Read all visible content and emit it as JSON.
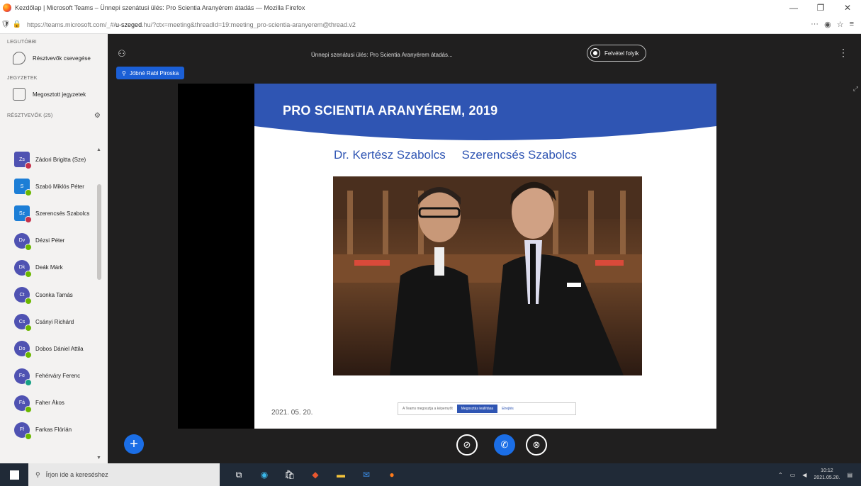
{
  "browser": {
    "title": "Kezdőlap | Microsoft Teams – Ünnepi szenátusi ülés: Pro Scientia Aranyérem átadás — Mozilla Firefox",
    "url_prefix": "https://teams.microsoft.com/_#/",
    "url_domain": "u-szeged",
    "url_rest": ".hu/?ctx=meeting&threadId=19:meeting_pro-scientia-aranyerem@thread.v2",
    "menu_glyph": "≡",
    "star_glyph": "☆",
    "dots_glyph": "···",
    "min_glyph": "—",
    "max_glyph": "❐",
    "close_glyph": "✕"
  },
  "sidebar": {
    "section_teams": "LEGUTÓBBI",
    "section_notes": "JEGYZETEK",
    "section_people": "RÉSZTVEVŐK (25)",
    "item_chat": "Résztvevők csevegése",
    "item_notes": "Megosztott jegyzetek",
    "gear_glyph": "⚙",
    "people": [
      {
        "initials": "Zs",
        "name": "Zádori Brigitta (Sze)",
        "shape": "sq",
        "status": "red",
        "color": ""
      },
      {
        "initials": "S",
        "name": "Szabó Miklós Péter",
        "shape": "sq",
        "status": "",
        "color": "blue"
      },
      {
        "initials": "Sz",
        "name": "Szerencsés Szabolcs",
        "shape": "sq",
        "status": "red",
        "color": "blue"
      },
      {
        "initials": "Dv",
        "name": "Dézsi Péter",
        "shape": "",
        "status": "",
        "color": ""
      },
      {
        "initials": "Dk",
        "name": "Deák Márk",
        "shape": "",
        "status": "",
        "color": ""
      },
      {
        "initials": "Ct",
        "name": "Csonka Tamás",
        "shape": "",
        "status": "",
        "color": ""
      },
      {
        "initials": "Cs",
        "name": "Csányi Richárd",
        "shape": "",
        "status": "",
        "color": ""
      },
      {
        "initials": "Do",
        "name": "Dobos Dániel Attila",
        "shape": "",
        "status": "",
        "color": ""
      },
      {
        "initials": "Fe",
        "name": "Fehérváry Ferenc",
        "shape": "",
        "status": "teal",
        "color": ""
      },
      {
        "initials": "Fá",
        "name": "Faher Ákos",
        "shape": "",
        "status": "",
        "color": ""
      },
      {
        "initials": "Ff",
        "name": "Farkas Flórián",
        "shape": "",
        "status": "",
        "color": ""
      }
    ]
  },
  "meeting": {
    "title": "Ünnepi szenátusi ülés: Pro Scientia Aranyérem átadás...",
    "live_label": "Felvétel folyik",
    "presenter": "Jóbné Rabl Piroska",
    "more_glyph": "⋮",
    "fab_glyph": "+",
    "mic_glyph": "🎤",
    "call_glyph": "✆",
    "cam_glyph": "📷"
  },
  "slide": {
    "title": "PRO SCIENTIA ARANYÉREM, 2019",
    "name_left": "Dr. Kertész Szabolcs",
    "name_right": "Szerencsés Szabolcs",
    "date": "2021. 05. 20.",
    "share_text": "A Teams megosztja a képernyőt",
    "share_stop": "Megosztás leállítása",
    "share_hide": "Elrejtés",
    "accent": "#2f55b3"
  },
  "taskbar": {
    "search_placeholder": "Írjon ide a kereséshez",
    "time": "10:12",
    "date": "2021.05.20."
  }
}
